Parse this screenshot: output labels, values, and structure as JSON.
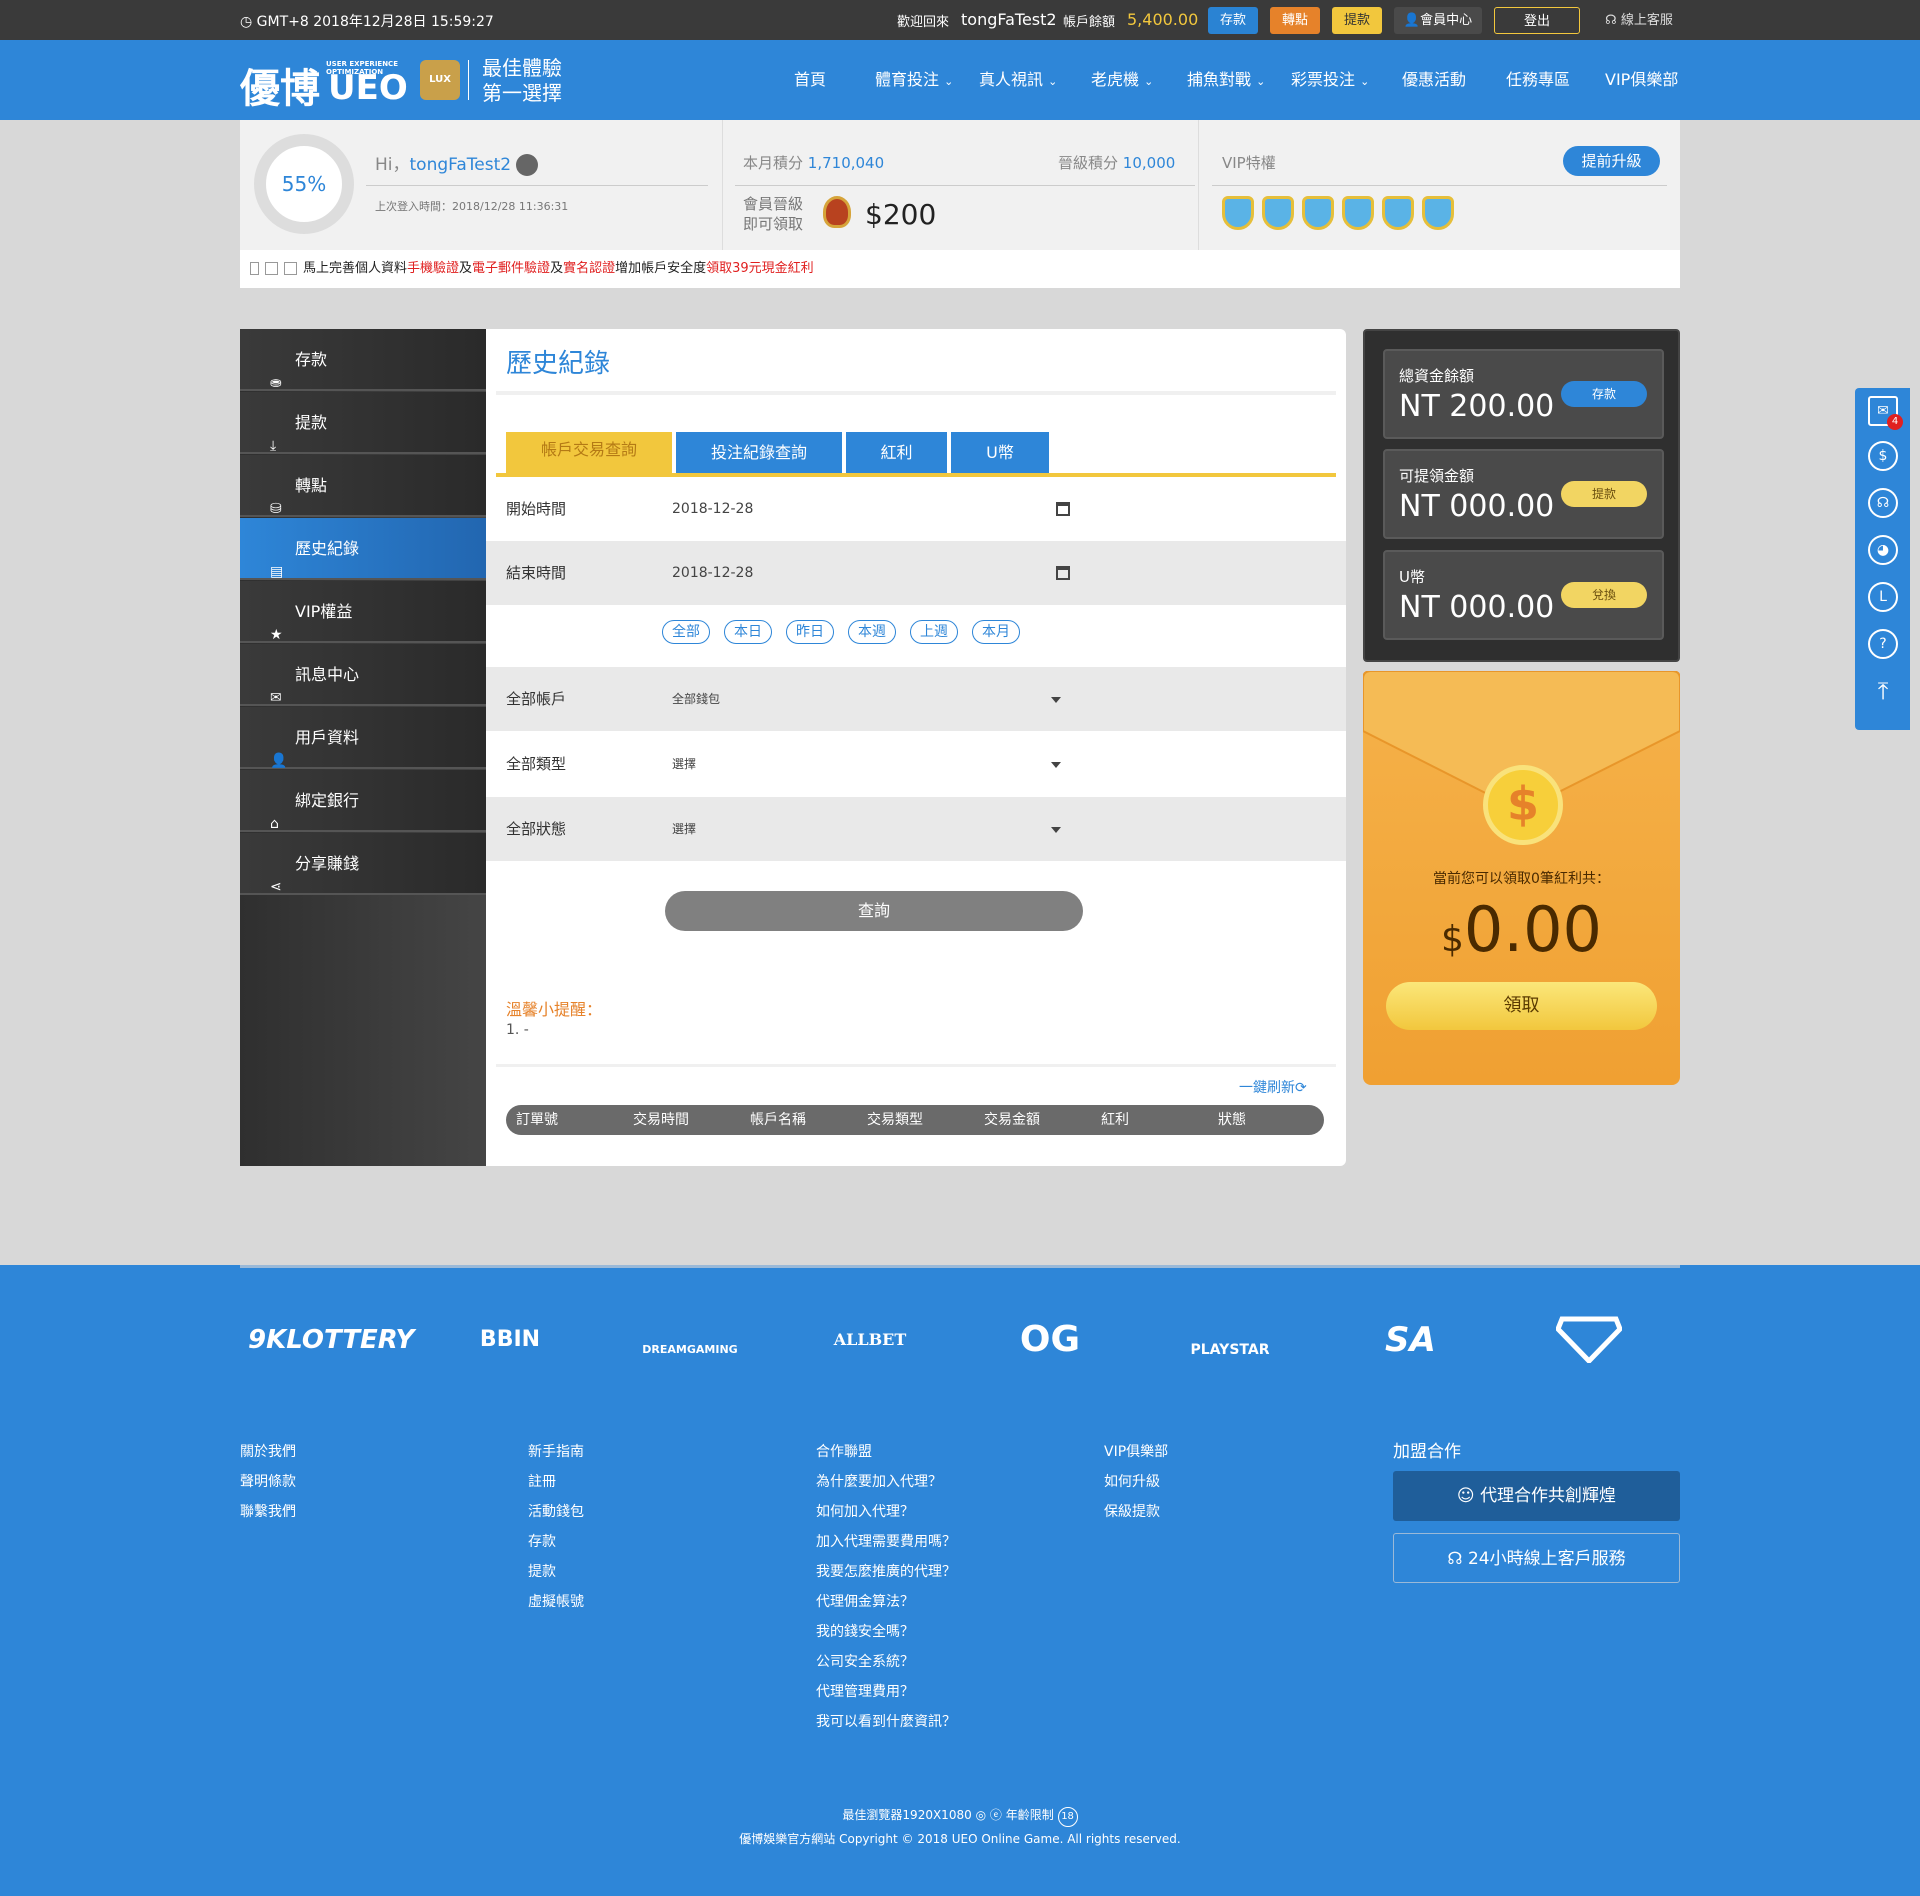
{
  "topbar": {
    "time": "GMT+8 2018年12月28日 15:59:27",
    "welcome": "歡迎回來",
    "username": "tongFaTest2",
    "balance_label": "帳戶餘額",
    "balance": "5,400.00",
    "buttons": {
      "deposit": "存款",
      "transfer": "轉點",
      "withdraw": "提款",
      "member": "會員中心",
      "logout": "登出",
      "support": "線上客服"
    }
  },
  "header": {
    "logo": {
      "brand": "優博",
      "ueo": "UEO",
      "sub": "USER EXPERIENCE OPTIMIZATION",
      "badge": "LUX",
      "slogan1": "最佳體驗",
      "slogan2": "第一選擇"
    },
    "nav": [
      "首頁",
      "體育投注",
      "真人視訊",
      "老虎機",
      "捕魚對戰",
      "彩票投注",
      "優惠活動",
      "任務專區",
      "VIP俱樂部"
    ]
  },
  "profile": {
    "progress": "55%",
    "hi": "Hi，",
    "username": "tongFaTest2",
    "last_login": "上次登入時間：2018/12/28 11:36:31",
    "month_points_label": "本月積分",
    "month_points": "1,710,040",
    "upgrade_points_label": "晉級積分",
    "upgrade_points": "10,000",
    "get_label1": "會員晉級",
    "get_label2": "即可領取",
    "reward": "$200",
    "vip_label": "VIP特權",
    "upgrade_button": "提前升級"
  },
  "notice": {
    "t1": "馬上完善個人資料",
    "r1": "手機驗證",
    "t2": "及",
    "r2": "電子郵件驗證",
    "t3": "及",
    "r3": "實名認證",
    "t4": "增加帳戶安全度",
    "r4": "領取39元現金紅利"
  },
  "sidebar": {
    "items": [
      {
        "label": "存款",
        "icon": "piggy-icon"
      },
      {
        "label": "提款",
        "icon": "hand-money-icon"
      },
      {
        "label": "轉點",
        "icon": "coins-icon"
      },
      {
        "label": "歷史紀錄",
        "icon": "document-icon"
      },
      {
        "label": "VIP權益",
        "icon": "star-icon"
      },
      {
        "label": "訊息中心",
        "icon": "envelope-icon"
      },
      {
        "label": "用戶資料",
        "icon": "user-icon"
      },
      {
        "label": "綁定銀行",
        "icon": "bank-icon"
      },
      {
        "label": "分享賺錢",
        "icon": "share-icon"
      }
    ],
    "active_index": 3
  },
  "main": {
    "title": "歷史紀錄",
    "tabs": [
      "帳戶交易查詢",
      "投注紀錄查詢",
      "紅利",
      "U幣"
    ],
    "start_label": "開始時間",
    "start_value": "2018-12-28",
    "end_label": "結束時間",
    "end_value": "2018-12-28",
    "quick": [
      "全部",
      "本日",
      "昨日",
      "本週",
      "上週",
      "本月"
    ],
    "account_label": "全部帳戶",
    "account_value": "全部錢包",
    "type_label": "全部類型",
    "type_value": "選擇",
    "status_label": "全部狀態",
    "status_value": "選擇",
    "query_button": "查詢",
    "tips_title": "溫馨小提醒：",
    "tip1": "1. -",
    "refresh": "一鍵刷新",
    "columns": [
      "訂單號",
      "交易時間",
      "帳戶名稱",
      "交易類型",
      "交易金額",
      "紅利",
      "狀態"
    ]
  },
  "wallet": {
    "total_label": "總資金餘額",
    "total_value": "NT 200.00",
    "total_button": "存款",
    "withdrawable_label": "可提領金額",
    "withdrawable_value": "NT 000.00",
    "withdrawable_button": "提款",
    "ucoin_label": "U幣",
    "ucoin_value": "NT 000.00",
    "ucoin_button": "兌換"
  },
  "bonus": {
    "coin_symbol": "$",
    "text": "當前您可以領取0筆紅利共：",
    "currency": "$",
    "amount": "0.00",
    "button": "領取"
  },
  "floatbar": {
    "mail_badge": "4"
  },
  "footer": {
    "partners": [
      "9KLOTTERY",
      "BBIN",
      "DREAMGAMING",
      "ALLBET",
      "OG",
      "PLAYSTAR",
      "SA",
      "SUPERMAN"
    ],
    "col1": [
      "關於我們",
      "聲明條款",
      "聯繫我們"
    ],
    "col2": [
      "新手指南",
      "註冊",
      "活動錢包",
      "存款",
      "提款",
      "虛擬帳號"
    ],
    "col3": [
      "合作聯盟",
      "為什麼要加入代理？",
      "如何加入代理？",
      "加入代理需要費用嗎？",
      "我要怎麼推廣的代理？",
      "代理佣金算法？",
      "我的錢安全嗎？",
      "公司安全系統？",
      "代理管理費用？",
      "我可以看到什麼資訊？"
    ],
    "col4": [
      "VIP俱樂部",
      "如何升級",
      "保級提款"
    ],
    "join_title": "加盟合作",
    "join_button": "代理合作共創輝煌",
    "service_button": "24小時線上客戶服務",
    "browser": "最佳瀏覽器1920X1080",
    "age": "年齡限制",
    "age_badge": "18",
    "copyright": "優博娛樂官方網站 Copyright © 2018 UEO Online Game. All rights reserved."
  },
  "colors": {
    "brand_blue": "#2e86d8",
    "accent_yellow": "#f2c73d",
    "accent_orange": "#e6822a",
    "dark": "#3a3a3a"
  }
}
